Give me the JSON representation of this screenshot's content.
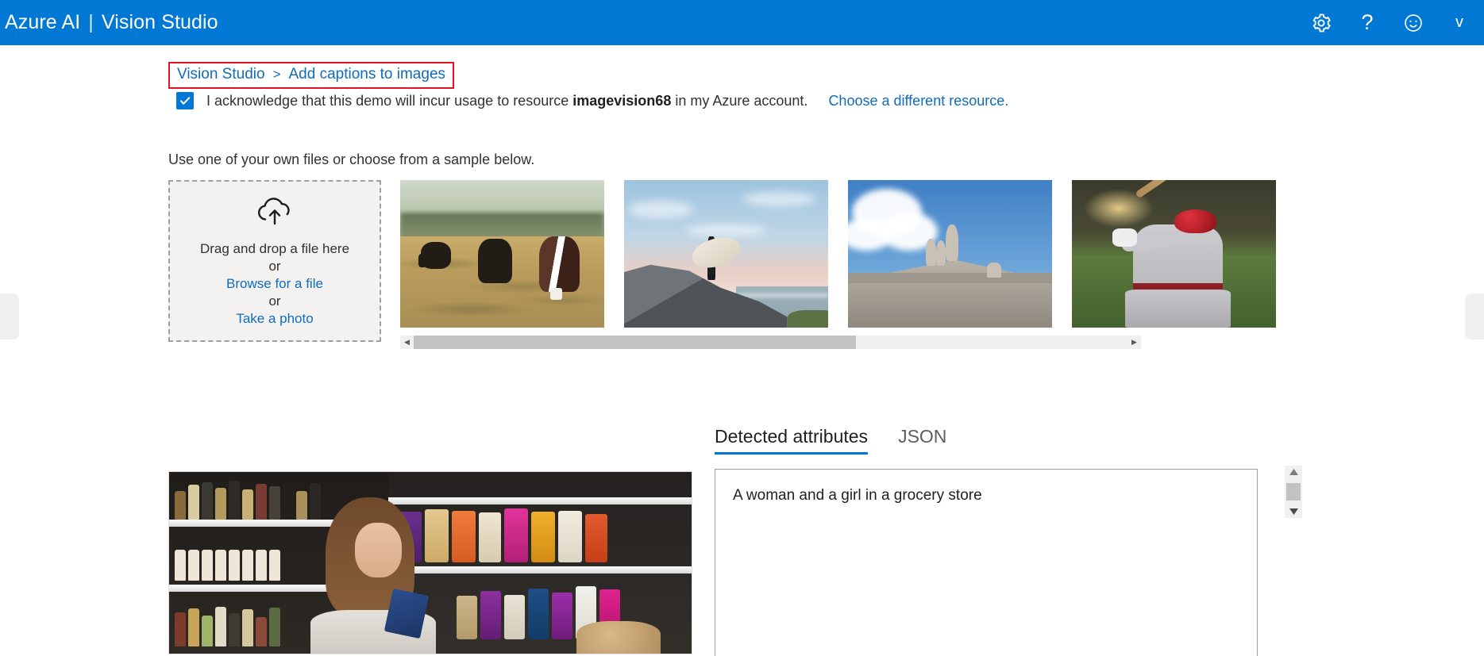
{
  "header": {
    "brand_primary": "Azure AI",
    "brand_separator": "|",
    "brand_secondary": "Vision Studio",
    "actions": [
      {
        "name": "settings",
        "icon": "gear-icon",
        "glyph": ""
      },
      {
        "name": "help",
        "icon": "question-mark-icon",
        "glyph": "?"
      },
      {
        "name": "feedback",
        "icon": "smiley-face-icon",
        "glyph": "☺"
      },
      {
        "name": "account",
        "icon": "chevron-down-icon",
        "glyph": "v"
      }
    ],
    "background_color": "#0078d4",
    "text_color": "#ffffff"
  },
  "breadcrumb": {
    "items": [
      {
        "label": "Vision Studio"
      },
      {
        "label": "Add captions to images"
      }
    ],
    "separator": ">",
    "highlight_color": "#e81123",
    "link_color": "#0f6cbd"
  },
  "acknowledgement": {
    "checked": true,
    "text_before": "I acknowledge that this demo will incur usage to resource",
    "resource_name": "imagevision68",
    "text_after": "in my Azure account.",
    "change_resource_link": "Choose a different resource."
  },
  "instructions": {
    "text": "Use one of your own files or choose from a sample below."
  },
  "dropzone": {
    "icon": "cloud-upload-icon",
    "drag_text": "Drag and drop a file here",
    "or_1": "or",
    "browse_link": "Browse for a file",
    "or_2": "or",
    "camera_link": "Take a photo"
  },
  "samples": {
    "items": [
      {
        "name": "sample-cows",
        "alt": "Cows grazing in a dry field at sunrise"
      },
      {
        "name": "sample-surfer",
        "alt": "Surfer holding a surfboard on a coastal rock"
      },
      {
        "name": "sample-statue",
        "alt": "Stone statues atop a classical building against blue sky"
      },
      {
        "name": "sample-baseball",
        "alt": "Baseball player in grey uniform with red helmet at bat"
      }
    ],
    "scrollbar": {
      "left_arrow": "◀",
      "right_arrow": "▶",
      "thumb_fraction": 0.62
    }
  },
  "results": {
    "tabs": [
      {
        "label": "Detected attributes",
        "active": true
      },
      {
        "label": "JSON",
        "active": false
      }
    ],
    "caption": "A woman and a girl in a grocery store",
    "image_alt": "Woman smiling and holding a phone in a grocery store aisle",
    "vertical_scrollbar": {
      "up_arrow": "▲",
      "down_arrow": "▼"
    }
  },
  "edge_panels": {
    "left_handle": "left-drawer-handle",
    "right_handle": "right-drawer-handle"
  }
}
